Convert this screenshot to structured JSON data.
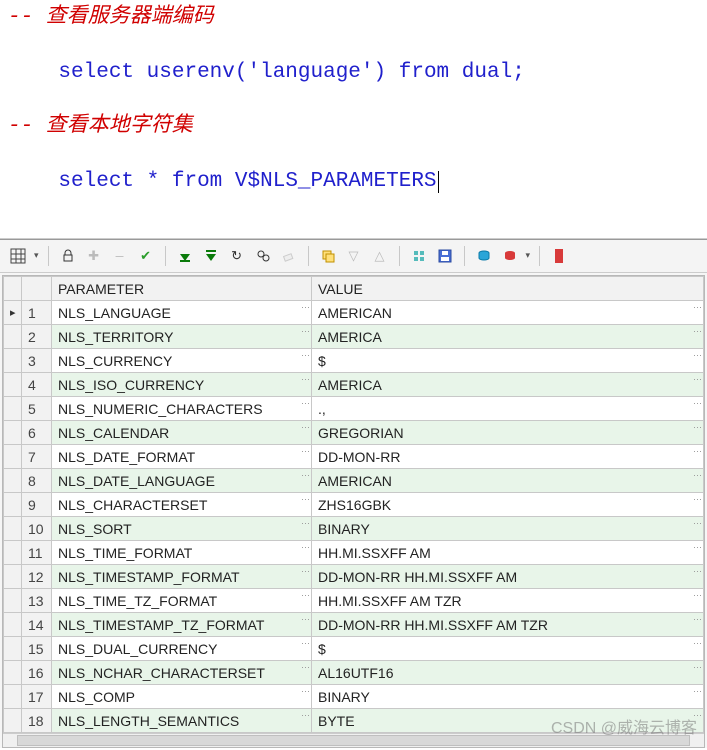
{
  "sql": {
    "line1": "-- 查看服务器端编码",
    "line2_select": "select",
    "line2_func": "userenv",
    "line2_paren_open": "(",
    "line2_string": "'language'",
    "line2_paren_close": ")",
    "line2_from": "from",
    "line2_dual": "dual",
    "line2_semi": ";",
    "line3": "-- 查看本地字符集",
    "line4_select": "select",
    "line4_star": "*",
    "line4_from": "from",
    "line4_table": "V$NLS_PARAMETERS"
  },
  "columns": {
    "param": "PARAMETER",
    "value": "VALUE"
  },
  "rows": [
    {
      "n": "1",
      "p": "NLS_LANGUAGE",
      "v": "AMERICAN"
    },
    {
      "n": "2",
      "p": "NLS_TERRITORY",
      "v": "AMERICA"
    },
    {
      "n": "3",
      "p": "NLS_CURRENCY",
      "v": "$"
    },
    {
      "n": "4",
      "p": "NLS_ISO_CURRENCY",
      "v": "AMERICA"
    },
    {
      "n": "5",
      "p": "NLS_NUMERIC_CHARACTERS",
      "v": ".,"
    },
    {
      "n": "6",
      "p": "NLS_CALENDAR",
      "v": "GREGORIAN"
    },
    {
      "n": "7",
      "p": "NLS_DATE_FORMAT",
      "v": "DD-MON-RR"
    },
    {
      "n": "8",
      "p": "NLS_DATE_LANGUAGE",
      "v": "AMERICAN"
    },
    {
      "n": "9",
      "p": "NLS_CHARACTERSET",
      "v": "ZHS16GBK"
    },
    {
      "n": "10",
      "p": "NLS_SORT",
      "v": "BINARY"
    },
    {
      "n": "11",
      "p": "NLS_TIME_FORMAT",
      "v": "HH.MI.SSXFF AM"
    },
    {
      "n": "12",
      "p": "NLS_TIMESTAMP_FORMAT",
      "v": "DD-MON-RR HH.MI.SSXFF AM"
    },
    {
      "n": "13",
      "p": "NLS_TIME_TZ_FORMAT",
      "v": "HH.MI.SSXFF AM TZR"
    },
    {
      "n": "14",
      "p": "NLS_TIMESTAMP_TZ_FORMAT",
      "v": "DD-MON-RR HH.MI.SSXFF AM TZR"
    },
    {
      "n": "15",
      "p": "NLS_DUAL_CURRENCY",
      "v": "$"
    },
    {
      "n": "16",
      "p": "NLS_NCHAR_CHARACTERSET",
      "v": "AL16UTF16"
    },
    {
      "n": "17",
      "p": "NLS_COMP",
      "v": "BINARY"
    },
    {
      "n": "18",
      "p": "NLS_LENGTH_SEMANTICS",
      "v": "BYTE"
    }
  ],
  "watermark": "CSDN @威海云博客"
}
